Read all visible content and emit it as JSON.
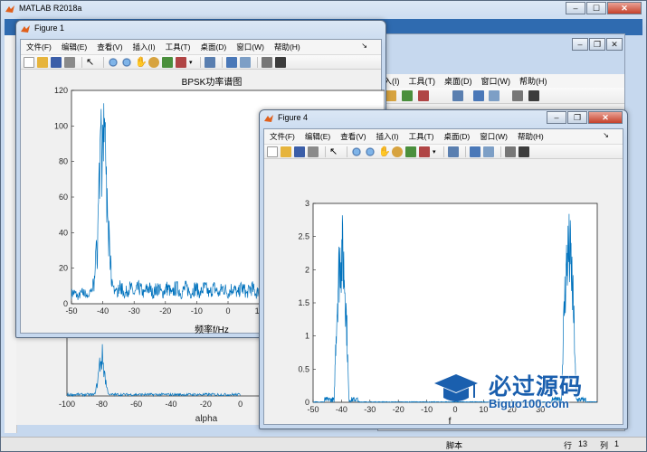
{
  "main_window": {
    "title": "MATLAB R2018a",
    "status_script": "脚本",
    "status_row_label": "行",
    "status_row": "13",
    "status_col_label": "列",
    "status_col": "1"
  },
  "menus": [
    "文件(F)",
    "编辑(E)",
    "查看(V)",
    "插入(I)",
    "工具(T)",
    "桌面(D)",
    "窗口(W)",
    "帮助(H)"
  ],
  "bg_menus": [
    "入(I)",
    "工具(T)",
    "桌面(D)",
    "窗口(W)",
    "帮助(H)"
  ],
  "figure1": {
    "title": "Figure 1",
    "chart_data": {
      "type": "line",
      "title": "BPSK功率谱图",
      "xlabel": "频率f/Hz",
      "ylabel": "",
      "xlim": [
        -50,
        50
      ],
      "ylim": [
        0,
        120
      ],
      "xticks": [
        -50,
        -40,
        -30,
        -20,
        -10,
        0,
        10
      ],
      "yticks": [
        0,
        20,
        40,
        60,
        80,
        100,
        120
      ],
      "series_color": "#0072bd",
      "peak_x": -40,
      "peak_y": 112,
      "sidelobe_level": 12
    }
  },
  "figure_behind": {
    "chart_data": {
      "type": "line",
      "xlabel": "alpha",
      "xlim": [
        -100,
        20
      ],
      "xticks": [
        -100,
        -80,
        -60,
        -40,
        -20,
        0,
        20
      ],
      "peak_x": -80
    }
  },
  "figure4": {
    "title": "Figure 4",
    "chart_data": {
      "type": "line",
      "xlabel": "f",
      "ylabel": "",
      "xlim": [
        -50,
        50
      ],
      "ylim": [
        0,
        3
      ],
      "xticks": [
        -50,
        -40,
        -30,
        -20,
        -10,
        0,
        10,
        20,
        30
      ],
      "yticks": [
        0,
        0.5,
        1,
        1.5,
        2,
        2.5,
        3
      ],
      "ytick_labels": [
        "0",
        "0.5",
        "1",
        "1.5",
        "2",
        "2.5",
        "3"
      ],
      "series_color": "#0072bd",
      "peaks": [
        -40,
        40
      ],
      "peak_y": 2.9
    }
  },
  "watermark": {
    "title": "必过源码",
    "url": "Biguo100.com"
  },
  "colors": {
    "plot_line": "#0072bd",
    "win_frame": "#c6d8ee",
    "close_button": "#c5412b"
  }
}
